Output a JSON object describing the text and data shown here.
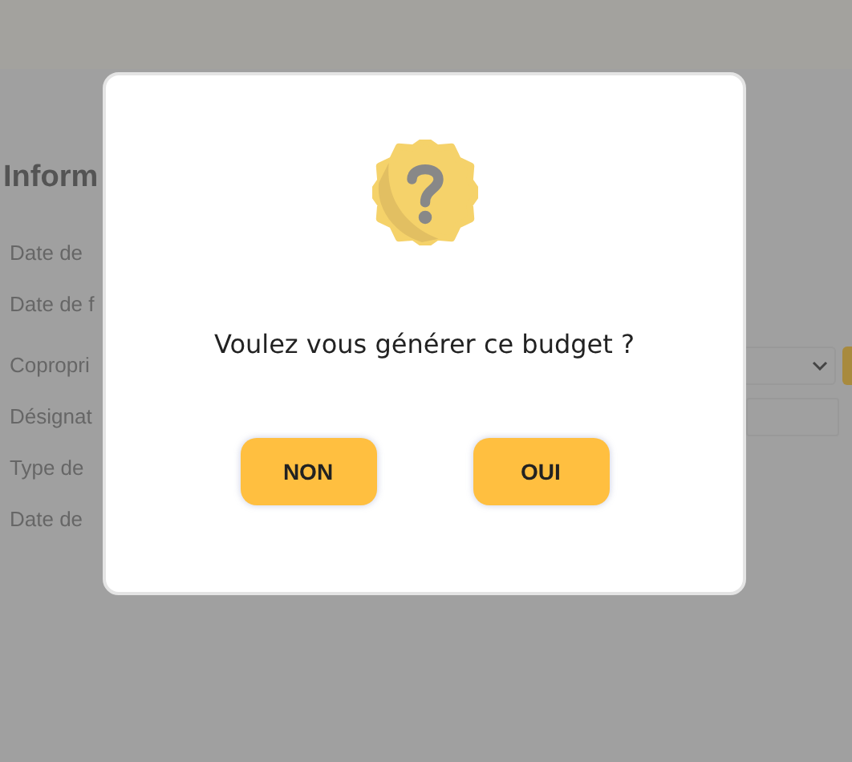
{
  "page": {
    "heading": "Inform",
    "fields": [
      {
        "label": "Date de",
        "kind": "text"
      },
      {
        "label": "Date de f",
        "kind": "text"
      },
      {
        "label": "Copropri",
        "kind": "select"
      },
      {
        "label": "Désignat",
        "kind": "input"
      },
      {
        "label": "Type de",
        "kind": "text"
      },
      {
        "label": "Date de",
        "kind": "text"
      }
    ]
  },
  "dialog": {
    "message": "Voulez vous générer ce budget ?",
    "buttons": [
      "NON",
      "OUI"
    ]
  }
}
